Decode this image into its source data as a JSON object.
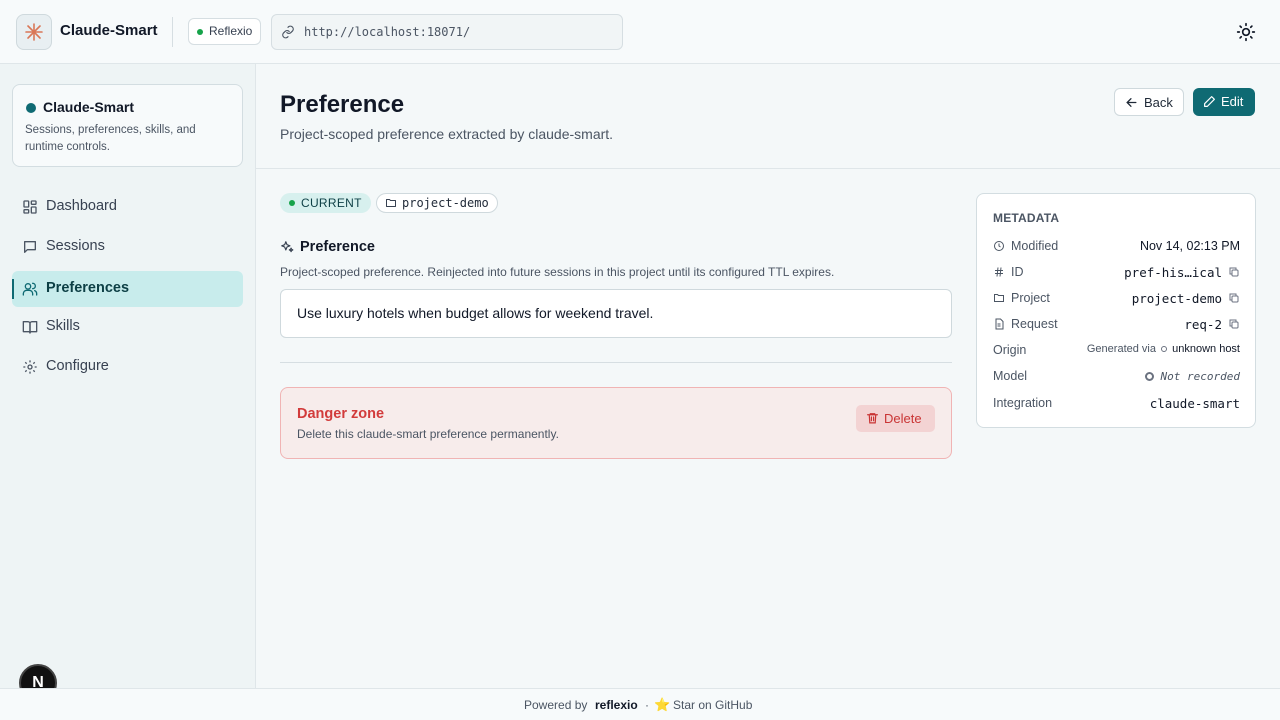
{
  "topbar": {
    "app_name": "Claude-Smart",
    "brand_pill": "Reflexio",
    "url": "http://localhost:18071/"
  },
  "sidebar": {
    "card_title": "Claude-Smart",
    "card_desc": "Sessions, preferences, skills, and runtime controls.",
    "items": [
      {
        "label": "Dashboard",
        "icon": "dashboard-icon"
      },
      {
        "label": "Sessions",
        "icon": "chat-icon"
      },
      {
        "label": "Preferences",
        "icon": "users-icon",
        "active": true
      },
      {
        "label": "Skills",
        "icon": "book-icon"
      },
      {
        "label": "Configure",
        "icon": "gear-icon"
      }
    ],
    "n_badge": "N"
  },
  "header": {
    "title": "Preference",
    "subtitle": "Project-scoped preference extracted by claude-smart.",
    "back_label": "Back",
    "edit_label": "Edit"
  },
  "content": {
    "status_chip": "CURRENT",
    "project_chip": "project-demo",
    "section_title": "Preference",
    "section_desc": "Project-scoped preference. Reinjected into future sessions in this project until its configured TTL expires.",
    "preference_text": "Use luxury hotels when budget allows for weekend travel."
  },
  "danger": {
    "title": "Danger zone",
    "desc": "Delete this claude-smart preference permanently.",
    "delete_label": "Delete"
  },
  "metadata": {
    "header": "METADATA",
    "modified_label": "Modified",
    "modified_value": "Nov 14, 02:13 PM",
    "id_label": "ID",
    "id_value": "pref-his…ical",
    "project_label": "Project",
    "project_value": "project-demo",
    "request_label": "Request",
    "request_value": "req-2",
    "origin_label": "Origin",
    "origin_prefix": "Generated via",
    "origin_value": "unknown host",
    "model_label": "Model",
    "model_value": "Not recorded",
    "integration_label": "Integration",
    "integration_value": "claude-smart"
  },
  "footer": {
    "powered_by": "Powered by",
    "brand": "reflexio",
    "separator": "·",
    "star_emoji": "⭐",
    "github": "Star on GitHub"
  },
  "colors": {
    "accent": "#0f6a73",
    "active_nav_bg": "#c8ecec",
    "danger": "#d23b3b",
    "status_green": "#16a34a"
  }
}
